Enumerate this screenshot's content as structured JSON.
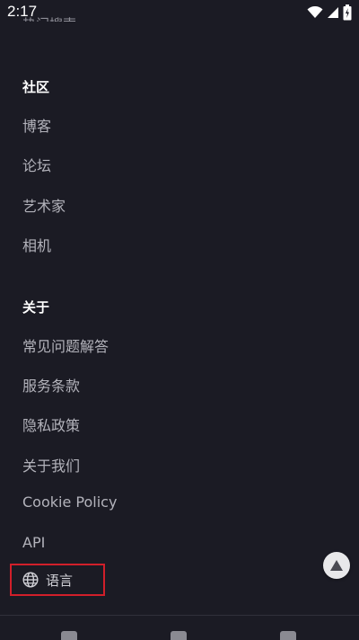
{
  "status_bar": {
    "time": "2:17"
  },
  "partial_item": "热门搜索",
  "sections": {
    "community": {
      "heading": "社区",
      "links": [
        "博客",
        "论坛",
        "艺术家",
        "相机"
      ]
    },
    "about": {
      "heading": "关于",
      "links": [
        "常见问题解答",
        "服务条款",
        "隐私政策",
        "关于我们",
        "Cookie Policy",
        "API"
      ]
    }
  },
  "language": {
    "label": "语言",
    "icon": "globe-icon"
  },
  "scroll_top": {
    "icon": "arrow-up-icon"
  },
  "social_icons": [
    "facebook-icon",
    "instagram-icon",
    "twitter-icon"
  ],
  "colors": {
    "background": "#1b1b24",
    "heading": "#ffffff",
    "link": "#b3b3bb",
    "highlight_border": "#d11f2a"
  }
}
